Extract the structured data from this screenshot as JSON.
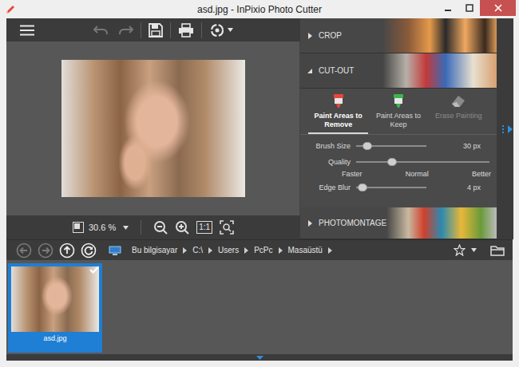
{
  "window": {
    "title": "asd.jpg - InPixio Photo Cutter"
  },
  "toolbar": [
    {
      "kind": "menu",
      "disabled": false
    },
    {
      "kind": "undo",
      "disabled": true
    },
    {
      "kind": "redo",
      "disabled": true
    },
    {
      "kind": "save",
      "disabled": false
    },
    {
      "kind": "print",
      "disabled": false
    },
    {
      "kind": "share",
      "disabled": false
    }
  ],
  "zoom": {
    "value": "30.6 %",
    "actual_size": "1:1"
  },
  "panels": [
    {
      "label": "CROP",
      "expanded": false
    },
    {
      "label": "CUT-OUT",
      "expanded": true
    },
    {
      "label": "PHOTOMONTAGE",
      "expanded": false
    }
  ],
  "tools": [
    {
      "label": "Paint Areas to Remove",
      "kind": "paint",
      "selected": true,
      "disabled": false,
      "color": "#e8453c"
    },
    {
      "label": "Paint Areas to Keep",
      "kind": "paint",
      "selected": false,
      "disabled": false,
      "color": "#3db54a"
    },
    {
      "label": "Erase Painting",
      "kind": "erase",
      "selected": false,
      "disabled": true,
      "color": "#8a8a8a"
    }
  ],
  "sliders": [
    {
      "label": "Brush Size",
      "kind": "reading",
      "level": 0.1,
      "reading": "30 px"
    },
    {
      "label": "Quality",
      "kind": "scale",
      "level": 0.25,
      "ticks": [
        "Faster",
        "Normal",
        "Better"
      ]
    },
    {
      "label": "Edge Blur",
      "kind": "reading",
      "level": 0.03,
      "reading": "4 px"
    }
  ],
  "nav": [
    {
      "kind": "back",
      "disabled": true
    },
    {
      "kind": "forward",
      "disabled": true
    },
    {
      "kind": "up",
      "disabled": false
    },
    {
      "kind": "refresh",
      "disabled": false
    }
  ],
  "path": [
    "Bu bilgisayar",
    "C:\\",
    "Users",
    "PcPc",
    "Masaüstü"
  ],
  "thumbnails": [
    {
      "name": "asd.jpg",
      "selected": true,
      "checked": true
    }
  ]
}
